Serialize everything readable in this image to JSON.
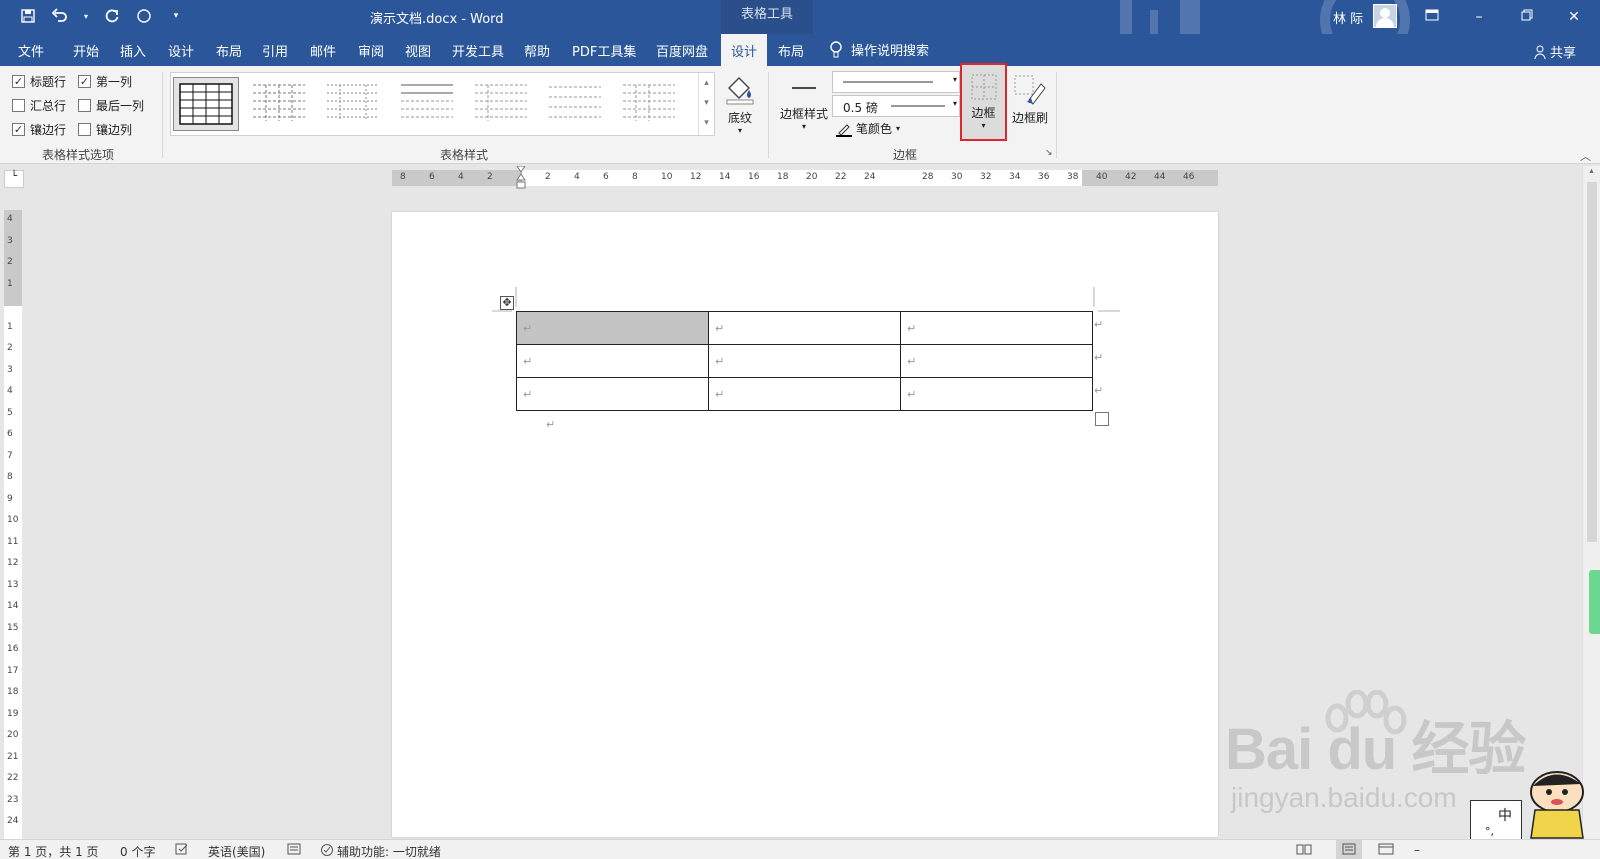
{
  "window": {
    "doc_title": "演示文档.docx  -  Word",
    "context_tab_group": "表格工具",
    "user_name": "林 际"
  },
  "quick_access": {
    "save": "save-icon",
    "undo": "undo-icon",
    "redo": "redo-icon",
    "touch": "touch-mode-icon",
    "customize": "customize-icon"
  },
  "tabs": {
    "file": "文件",
    "home": "开始",
    "insert": "插入",
    "design": "设计",
    "layout": "布局",
    "references": "引用",
    "mailings": "邮件",
    "review": "审阅",
    "view": "视图",
    "developer": "开发工具",
    "help": "帮助",
    "pdf": "PDF工具集",
    "baidu": "百度网盘",
    "table_design": "设计",
    "table_layout": "布局"
  },
  "tell_me": "操作说明搜索",
  "share": "共享",
  "ribbon": {
    "style_options": {
      "header_row": "标题行",
      "first_column": "第一列",
      "total_row": "汇总行",
      "last_column": "最后一列",
      "banded_rows": "镶边行",
      "banded_columns": "镶边列",
      "group_label": "表格样式选项",
      "checked": {
        "header_row": true,
        "first_column": true,
        "total_row": false,
        "last_column": false,
        "banded_rows": true,
        "banded_columns": false
      }
    },
    "table_styles": {
      "group_label": "表格样式"
    },
    "shading_label": "底纹",
    "borders": {
      "border_styles_label": "边框样式",
      "pen_weight": "0.5 磅",
      "pen_color_label": "笔颜色",
      "borders_label": "边框",
      "border_painter_label": "边框刷",
      "group_label": "边框"
    }
  },
  "ruler": {
    "h_numbers": [
      "8",
      "6",
      "4",
      "2",
      "",
      "2",
      "4",
      "6",
      "8",
      "10",
      "12",
      "14",
      "16",
      "18",
      "20",
      "22",
      "24",
      "",
      "28",
      "30",
      "32",
      "34",
      "36",
      "38",
      "40",
      "42",
      "44",
      "46"
    ],
    "v_numbers": [
      "4",
      "3",
      "2",
      "1",
      "",
      "1",
      "2",
      "3",
      "4",
      "5",
      "6",
      "7",
      "8",
      "9",
      "10",
      "11",
      "12",
      "13",
      "14",
      "15",
      "16",
      "17",
      "18",
      "19",
      "20",
      "21",
      "22",
      "23",
      "24"
    ]
  },
  "document": {
    "table_rows": [
      [
        "↵",
        "↵",
        "↵"
      ],
      [
        "↵",
        "↵",
        "↵"
      ],
      [
        "↵",
        "↵",
        "↵"
      ]
    ],
    "end_marks": [
      "↵",
      "↵",
      "↵"
    ],
    "after_table_mark": "↵"
  },
  "status": {
    "page": "第 1 页，共 1 页",
    "words": "0 个字",
    "language": "英语(美国)",
    "accessibility": "辅助功能: 一切就绪"
  },
  "watermark": {
    "brand": "Bai du 经验",
    "url": "jingyan.baidu.com"
  },
  "ime": {
    "mode": "中",
    "punct": "°,"
  }
}
